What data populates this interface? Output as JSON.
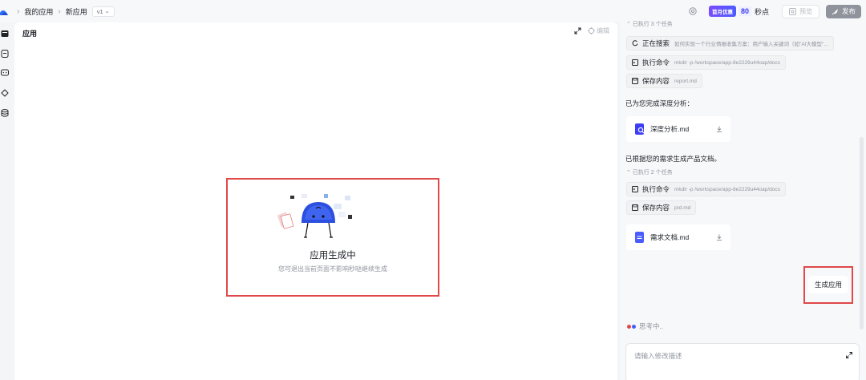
{
  "breadcrumb": {
    "my_apps": "我的应用",
    "current": "新应用",
    "version": "v1"
  },
  "header": {
    "badge": "首月优惠",
    "points_value": "80",
    "points_unit": "秒点",
    "preview_label": "预览",
    "publish_label": "发布"
  },
  "main": {
    "title": "应用",
    "edit_label": "编辑",
    "gen_title": "应用生成中",
    "gen_subtitle": "您可退出当前页面不影响秒哒继续生成"
  },
  "chat": {
    "top_collapse": "已执行 3 个任务",
    "tasks_group1": [
      {
        "name": "正在搜索",
        "detail": "如何实现一个行业情报收集方案：用户输入关键词（如\"AI大模型\"..."
      },
      {
        "name": "执行命令",
        "detail": "mkdir -p /workspace/app-8e2229u44oap/docs"
      },
      {
        "name": "保存内容",
        "detail": "report.md"
      }
    ],
    "analysis_done": "已为您完成深度分析：",
    "file1": "深度分析.md",
    "prd_done": "已根据您的需求生成产品文档。",
    "collapse2": "已执行 2 个任务",
    "tasks_group2": [
      {
        "name": "执行命令",
        "detail": "mkdir -p /workspace/app-8e2229u44oap/docs"
      },
      {
        "name": "保存内容",
        "detail": "prd.md"
      }
    ],
    "file2": "需求文档.md",
    "gen_app_label": "生成应用",
    "thinking": "思考中..",
    "input_placeholder": "请输入修改描述"
  },
  "colors": {
    "accent": "#3d3df5",
    "highlight_border": "#e0484a",
    "publish_bg": "#8f949c"
  }
}
